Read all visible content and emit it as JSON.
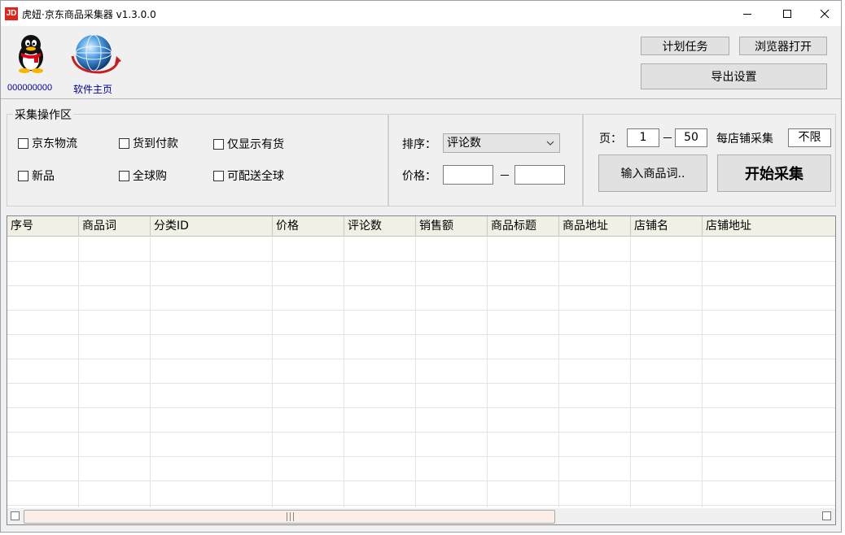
{
  "window": {
    "title": "虎妞·京东商品采集器 v1.3.0.0",
    "icon_text": "JD",
    "buttons": {
      "minimize": "minimize-icon",
      "maximize": "maximize-icon",
      "close": "close-icon"
    }
  },
  "header": {
    "qq_number": "000000000",
    "home_label": "软件主页",
    "plan_button": "计划任务",
    "browser_button": "浏览器打开",
    "export_button": "导出设置"
  },
  "filters": {
    "group_title": "采集操作区",
    "checkboxes": [
      {
        "label": "京东物流",
        "checked": false
      },
      {
        "label": "货到付款",
        "checked": false
      },
      {
        "label": "仅显示有货",
        "checked": false
      },
      {
        "label": "新品",
        "checked": false
      },
      {
        "label": "全球购",
        "checked": false
      },
      {
        "label": "可配送全球",
        "checked": false
      }
    ]
  },
  "sort": {
    "label": "排序：",
    "value": "评论数",
    "price_label": "价格：",
    "price_min": "",
    "price_max": "",
    "dash": "－"
  },
  "pages": {
    "label": "页：",
    "from": "1",
    "dash": "－",
    "to": "50",
    "per_shop_label": "每店铺采集",
    "per_shop_value": "不限",
    "keywords_button": "输入商品词..",
    "start_button": "开始采集"
  },
  "table": {
    "columns": [
      "序号",
      "商品词",
      "分类ID",
      "价格",
      "评论数",
      "销售额",
      "商品标题",
      "商品地址",
      "店铺名",
      "店铺地址"
    ],
    "rows": []
  }
}
